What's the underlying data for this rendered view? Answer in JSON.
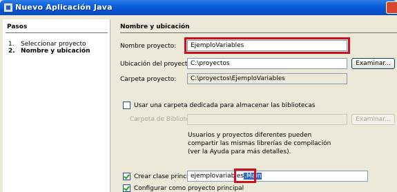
{
  "window": {
    "title": "Nuevo Aplicación Java"
  },
  "sidebar": {
    "header": "Pasos",
    "steps": [
      {
        "num": "1.",
        "label": "Seleccionar proyecto"
      },
      {
        "num": "2.",
        "label": "Nombre y ubicación"
      }
    ]
  },
  "main": {
    "section_title": "Nombre y ubicación",
    "project_name_label": "Nombre proyecto:",
    "project_name_value": "EjemploVariables",
    "location_label": "Ubicación del proyecto:",
    "location_value": "C:\\proyectos",
    "browse_label": "Examinar...",
    "folder_label": "Carpeta proyecto:",
    "folder_value": "C:\\proyectos\\EjemploVariables",
    "dedicated_folder_label": "Usar una carpeta dedicada para almacenar las bibliotecas",
    "libraries_folder_label": "Carpeta de Bibliotecas:",
    "libraries_folder_value": "",
    "browse_disabled_label": "Examinar...",
    "info_text": "Usuarios y proyectos diferentes pueden compartir las mismas librerías de compilación (ver la Ayuda para más detalles).",
    "create_main_label": "Crear clase principal",
    "main_class_prefix": "ejemplovariables",
    "main_class_selected": ".Main",
    "set_main_project_label": "Configurar como proyecto principal"
  }
}
